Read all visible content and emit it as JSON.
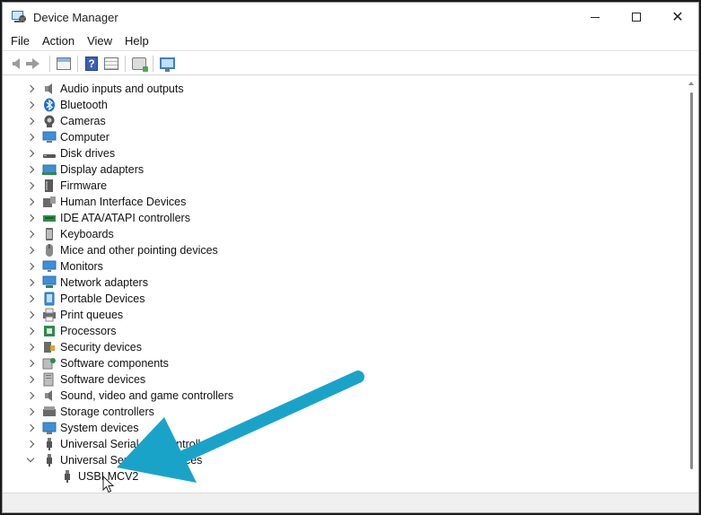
{
  "window": {
    "title": "Device Manager",
    "controls": {
      "minimize": "minimize",
      "maximize": "maximize",
      "close": "✕"
    }
  },
  "menu": [
    "File",
    "Action",
    "View",
    "Help"
  ],
  "toolbar": {
    "icons": [
      "back-arrow-icon",
      "forward-arrow-icon",
      "show-hide-console-tree-icon",
      "help-icon",
      "properties-icon",
      "update-driver-icon",
      "scan-hardware-changes-icon"
    ]
  },
  "tree": {
    "categories": [
      {
        "label": "Audio inputs and outputs",
        "icon": "speaker-icon",
        "expanded": false
      },
      {
        "label": "Bluetooth",
        "icon": "bluetooth-icon",
        "expanded": false
      },
      {
        "label": "Cameras",
        "icon": "camera-icon",
        "expanded": false
      },
      {
        "label": "Computer",
        "icon": "computer-icon",
        "expanded": false
      },
      {
        "label": "Disk drives",
        "icon": "disk-drive-icon",
        "expanded": false
      },
      {
        "label": "Display adapters",
        "icon": "display-adapter-icon",
        "expanded": false
      },
      {
        "label": "Firmware",
        "icon": "firmware-icon",
        "expanded": false
      },
      {
        "label": "Human Interface Devices",
        "icon": "hid-icon",
        "expanded": false
      },
      {
        "label": "IDE ATA/ATAPI controllers",
        "icon": "ide-controller-icon",
        "expanded": false
      },
      {
        "label": "Keyboards",
        "icon": "keyboard-icon",
        "expanded": false
      },
      {
        "label": "Mice and other pointing devices",
        "icon": "mouse-icon",
        "expanded": false
      },
      {
        "label": "Monitors",
        "icon": "monitor-icon",
        "expanded": false
      },
      {
        "label": "Network adapters",
        "icon": "network-adapter-icon",
        "expanded": false
      },
      {
        "label": "Portable Devices",
        "icon": "portable-device-icon",
        "expanded": false
      },
      {
        "label": "Print queues",
        "icon": "printer-icon",
        "expanded": false
      },
      {
        "label": "Processors",
        "icon": "processor-icon",
        "expanded": false
      },
      {
        "label": "Security devices",
        "icon": "security-device-icon",
        "expanded": false
      },
      {
        "label": "Software components",
        "icon": "software-component-icon",
        "expanded": false
      },
      {
        "label": "Software devices",
        "icon": "software-device-icon",
        "expanded": false
      },
      {
        "label": "Sound, video and game controllers",
        "icon": "speaker-icon",
        "expanded": false
      },
      {
        "label": "Storage controllers",
        "icon": "storage-controller-icon",
        "expanded": false
      },
      {
        "label": "System devices",
        "icon": "system-device-icon",
        "expanded": false
      },
      {
        "label": "Universal Serial Bus controllers",
        "icon": "usb-icon",
        "expanded": false
      },
      {
        "label": "Universal Serial Bus devices",
        "icon": "usb-icon",
        "expanded": true
      }
    ],
    "child": {
      "label": "USBLMCV2",
      "icon": "usb-icon"
    }
  },
  "colors": {
    "annotation_arrow": "#1aa3c9",
    "monitor_blue": "#3f8fd6"
  }
}
